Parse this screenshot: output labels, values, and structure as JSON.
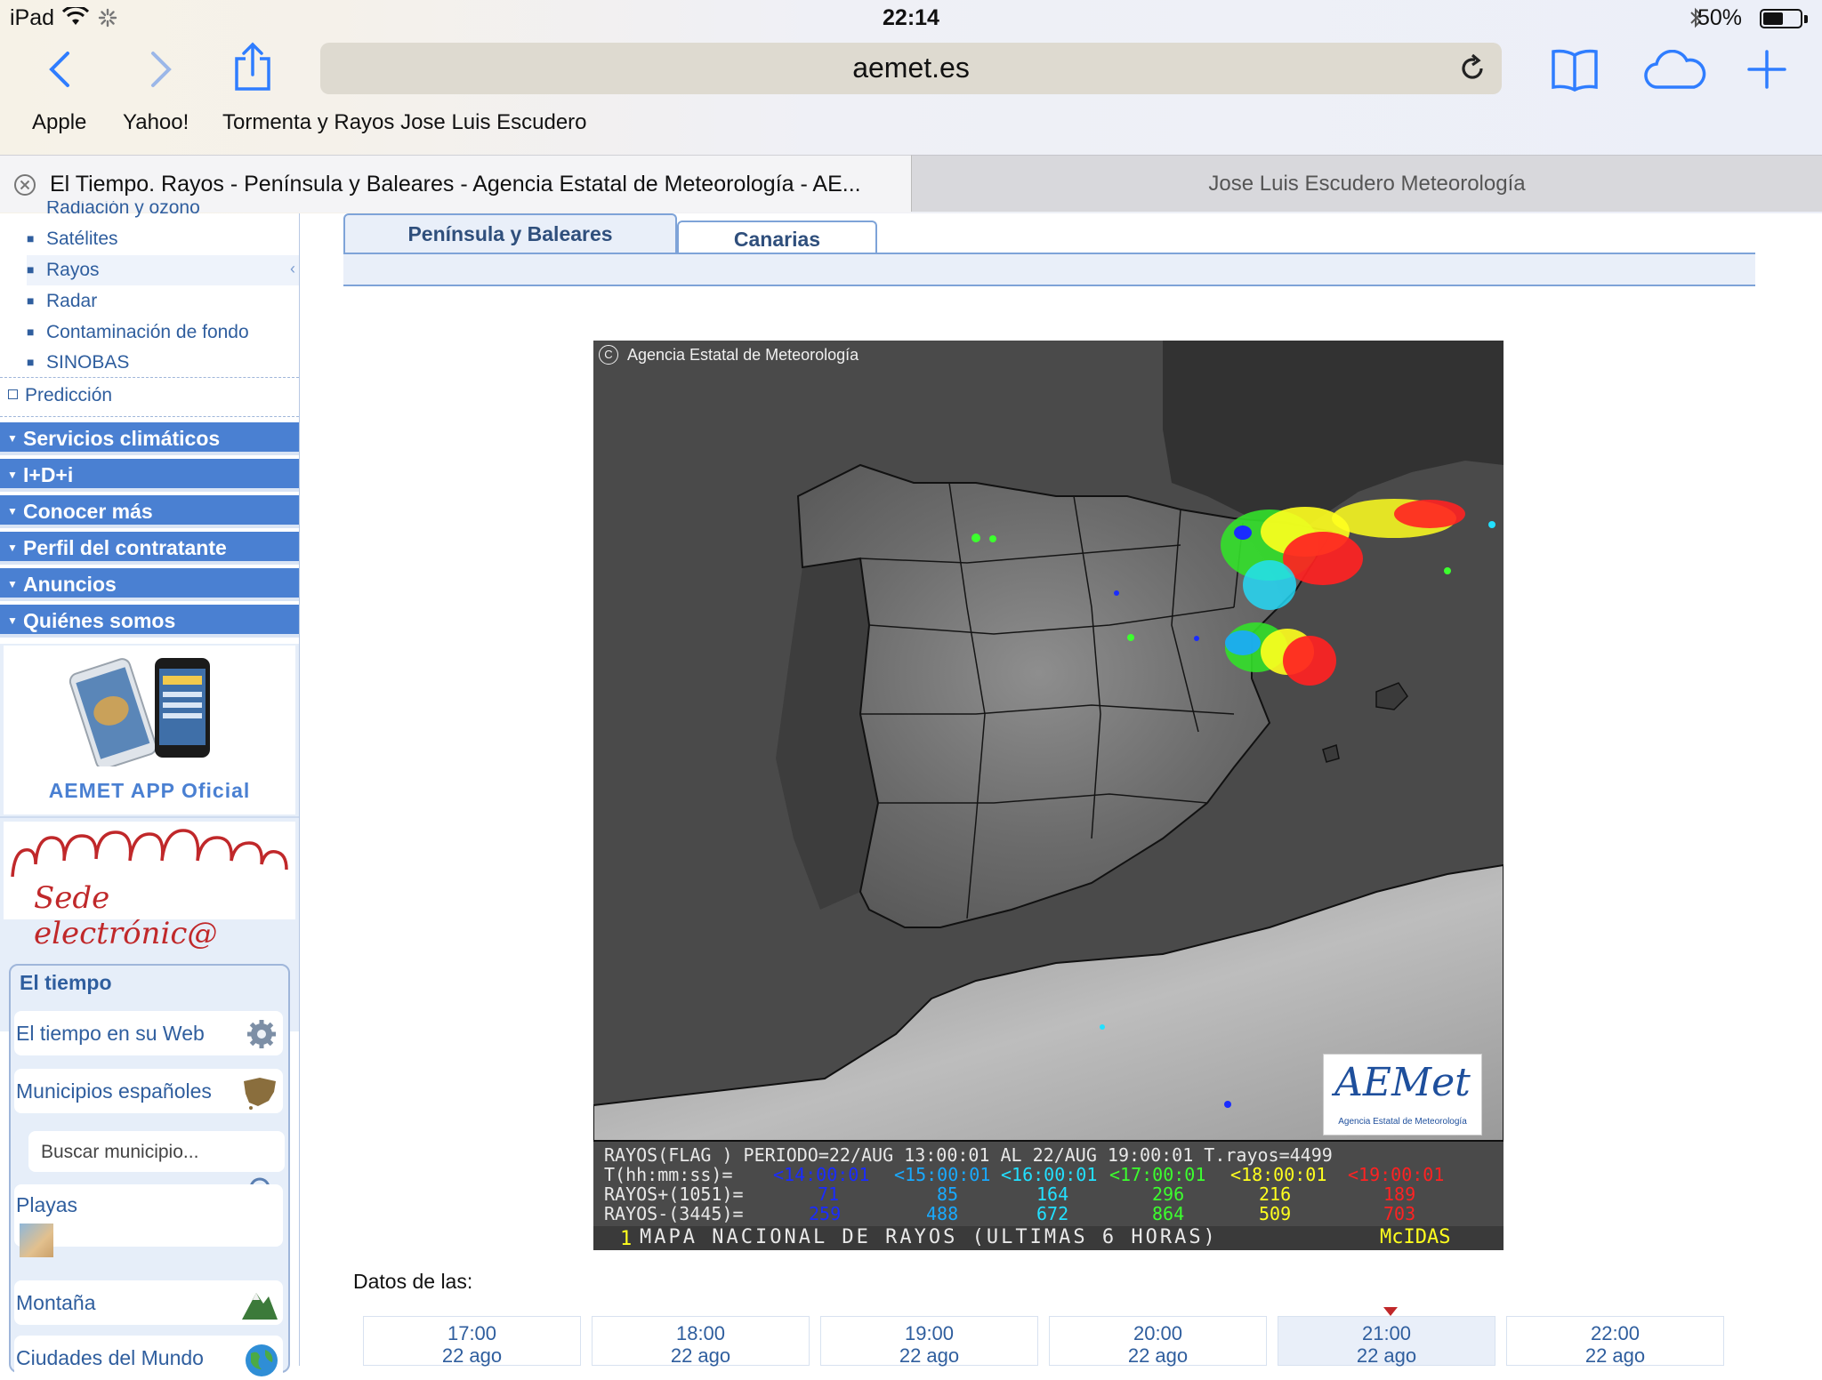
{
  "status_bar": {
    "device": "iPad",
    "time": "22:14",
    "battery": "50%",
    "battery_level": 0.5
  },
  "browser": {
    "url": "aemet.es",
    "bookmarks": [
      "Apple",
      "Yahoo!",
      "Tormenta y Rayos Jose Luis Escudero"
    ],
    "tabs": [
      {
        "title": "El Tiempo. Rayos - Península y Baleares - Agencia Estatal de Meteorología - AE...",
        "active": true
      },
      {
        "title": "Jose Luis Escudero Meteorología",
        "active": false
      }
    ]
  },
  "sidebar": {
    "cut_item": "Radiación y ozono",
    "sub_items": [
      "Satélites",
      "Rayos",
      "Radar",
      "Contaminación de fondo",
      "SINOBAS"
    ],
    "selected_sub_item": "Rayos",
    "prediccion": "Predicción",
    "categories": [
      "Servicios climáticos",
      "I+D+i",
      "Conocer más",
      "Perfil del contratante",
      "Anuncios",
      "Quiénes somos"
    ],
    "app_promo": "AEMET APP Oficial",
    "sede": "Sede electrónic@",
    "el_tiempo": {
      "title": "El tiempo",
      "items": [
        "El tiempo en su Web",
        "Municipios españoles"
      ],
      "search_placeholder": "Buscar municipio...",
      "more_items": [
        "Playas",
        "Montaña",
        "Ciudades del Mundo"
      ]
    }
  },
  "main": {
    "region_tabs": [
      "Península y Baleares",
      "Canarias"
    ],
    "active_region_tab": "Península y Baleares",
    "map": {
      "copyright": "Agencia Estatal de Meteorología",
      "logo_text": "AEMet",
      "logo_subtext": "Agencia Estatal de Meteorología",
      "period_line": "RAYOS(FLAG ) PERIODO=22/AUG 13:00:01 AL 22/AUG 19:00:01   T.rayos=4499",
      "time_label": "T(hh:mm:ss)=",
      "time_slots": [
        "<14:00:01",
        "<15:00:01",
        "<16:00:01",
        "<17:00:01",
        "<18:00:01",
        "<19:00:01"
      ],
      "slot_colors": [
        "#1a2cff",
        "#19aaff",
        "#22e0ff",
        "#3cff2e",
        "#ffff1e",
        "#ff2222"
      ],
      "positive_label": "RAYOS+(1051)=",
      "positive_values": [
        "71",
        "85",
        "164",
        "296",
        "216",
        "189"
      ],
      "negative_label": "RAYOS-(3445)=",
      "negative_values": [
        "259",
        "488",
        "672",
        "864",
        "509",
        "703"
      ],
      "footer_index": "1",
      "footer_title": "MAPA NACIONAL DE RAYOS (ULTIMAS 6 HORAS)",
      "footer_brand": "McIDAS"
    },
    "data_label": "Datos de las:",
    "times": [
      {
        "time": "17:00",
        "date": "22 ago"
      },
      {
        "time": "18:00",
        "date": "22 ago"
      },
      {
        "time": "19:00",
        "date": "22 ago"
      },
      {
        "time": "20:00",
        "date": "22 ago"
      },
      {
        "time": "21:00",
        "date": "22 ago"
      },
      {
        "time": "22:00",
        "date": "22 ago"
      }
    ],
    "selected_time": "21:00"
  }
}
